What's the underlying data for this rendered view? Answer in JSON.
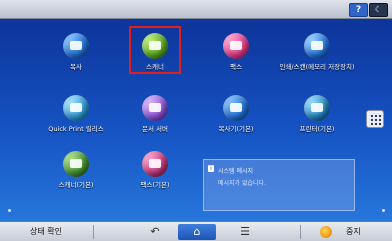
{
  "topbar": {
    "help_label": "?",
    "moon_label": "☾"
  },
  "apps": [
    {
      "label": "복사",
      "color": "#1f6fd6"
    },
    {
      "label": "스캐너",
      "color": "#58a51f"
    },
    {
      "label": "팩스",
      "color": "#e23b8a"
    },
    {
      "label": "인쇄/스캔(메모리 저장장치)",
      "color": "#1d6fd9"
    },
    {
      "label": "Quick Print 릴리스",
      "color": "#2b9ad6"
    },
    {
      "label": "문서 서버",
      "color": "#8b4fd6"
    },
    {
      "label": "복사기(기본)",
      "color": "#1f6fd6"
    },
    {
      "label": "프린터(기본)",
      "color": "#1f7fbf"
    },
    {
      "label": "스캐너(기본)",
      "color": "#3f8f2f"
    },
    {
      "label": "팩스(기본)",
      "color": "#c03377"
    }
  ],
  "notice": {
    "title": "시스템 메시지",
    "message": "메시지가 없습니다."
  },
  "bottom": {
    "status_label": "상태 확인",
    "back_label": "↶",
    "home_label": "⌂",
    "menu_label": "☰",
    "stop_label": "중지"
  },
  "selected_app": "스캐너"
}
